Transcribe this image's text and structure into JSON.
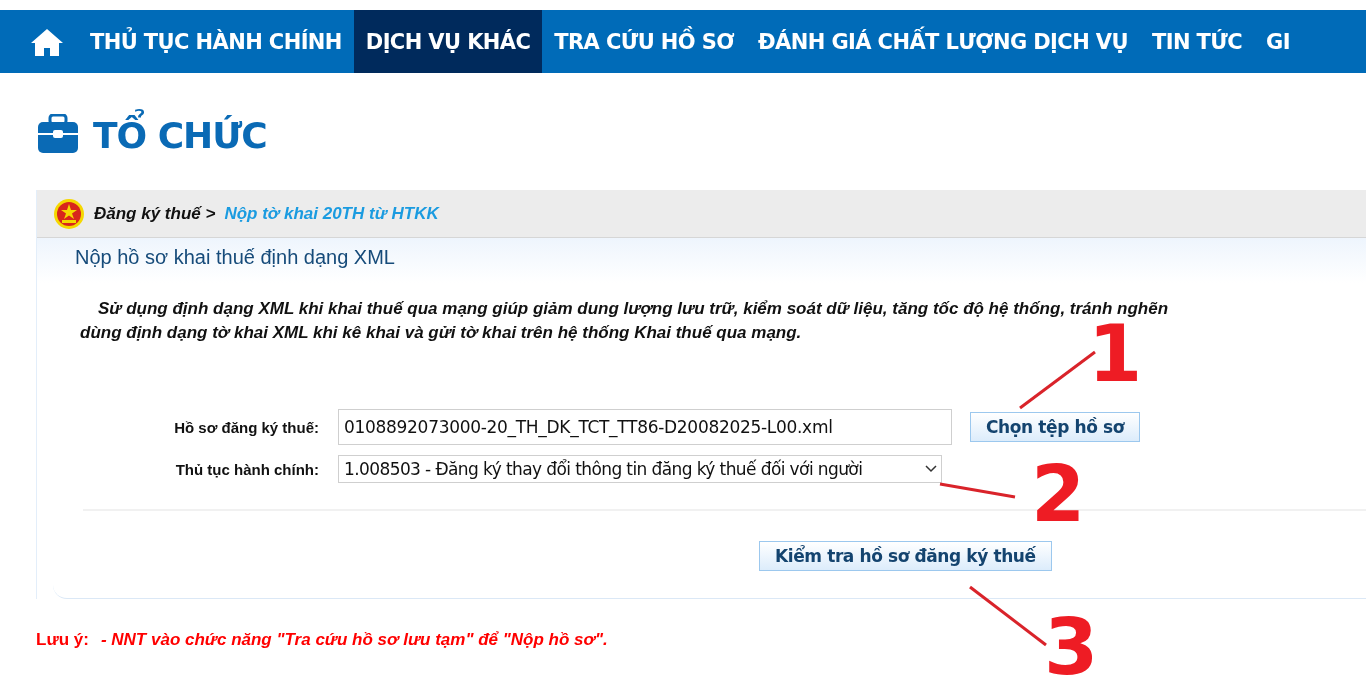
{
  "nav": {
    "items": [
      {
        "label": "THỦ TỤC HÀNH CHÍNH",
        "selected": false
      },
      {
        "label": "DỊCH VỤ KHÁC",
        "selected": true
      },
      {
        "label": "TRA CỨU HỒ SƠ",
        "selected": false
      },
      {
        "label": "ĐÁNH GIÁ CHẤT LƯỢNG DỊCH VỤ",
        "selected": false
      },
      {
        "label": "TIN TỨC",
        "selected": false
      },
      {
        "label": "GI",
        "selected": false
      }
    ]
  },
  "page_title": "TỔ CHỨC",
  "breadcrumb": {
    "parent": "Đăng ký thuế >",
    "current": "Nộp tờ khai 20TH từ HTKK"
  },
  "panel": {
    "title": "Nộp hồ sơ khai thuế định dạng XML",
    "intro_lines": [
      "Sử dụng định dạng XML khi khai thuế qua mạng giúp giảm dung lượng lưu trữ, kiểm soát dữ liệu, tăng tốc độ hệ thống, tránh nghẽn",
      "dùng định dạng tờ khai XML khi kê khai và gửi tờ khai trên hệ thống Khai thuế qua mạng."
    ],
    "fields": [
      {
        "kind": "file",
        "label": "Hồ sơ đăng ký thuế:",
        "value": "0108892073000-20_TH_DK_TCT_TT86-D20082025-L00.xml",
        "button": "Chọn tệp hồ sơ"
      },
      {
        "kind": "select",
        "label": "Thủ tục hành chính:",
        "value": "1.008503 - Đăng ký thay đổi thông tin đăng ký thuế đối với người"
      }
    ],
    "submit": "Kiểm tra hồ sơ đăng ký thuế"
  },
  "note": {
    "label": "Lưu ý:",
    "text": "- NNT vào chức năng \"Tra cứu hồ sơ lưu tạm\" để \"Nộp hồ sơ\"."
  },
  "annotations": [
    "1",
    "2",
    "3"
  ]
}
